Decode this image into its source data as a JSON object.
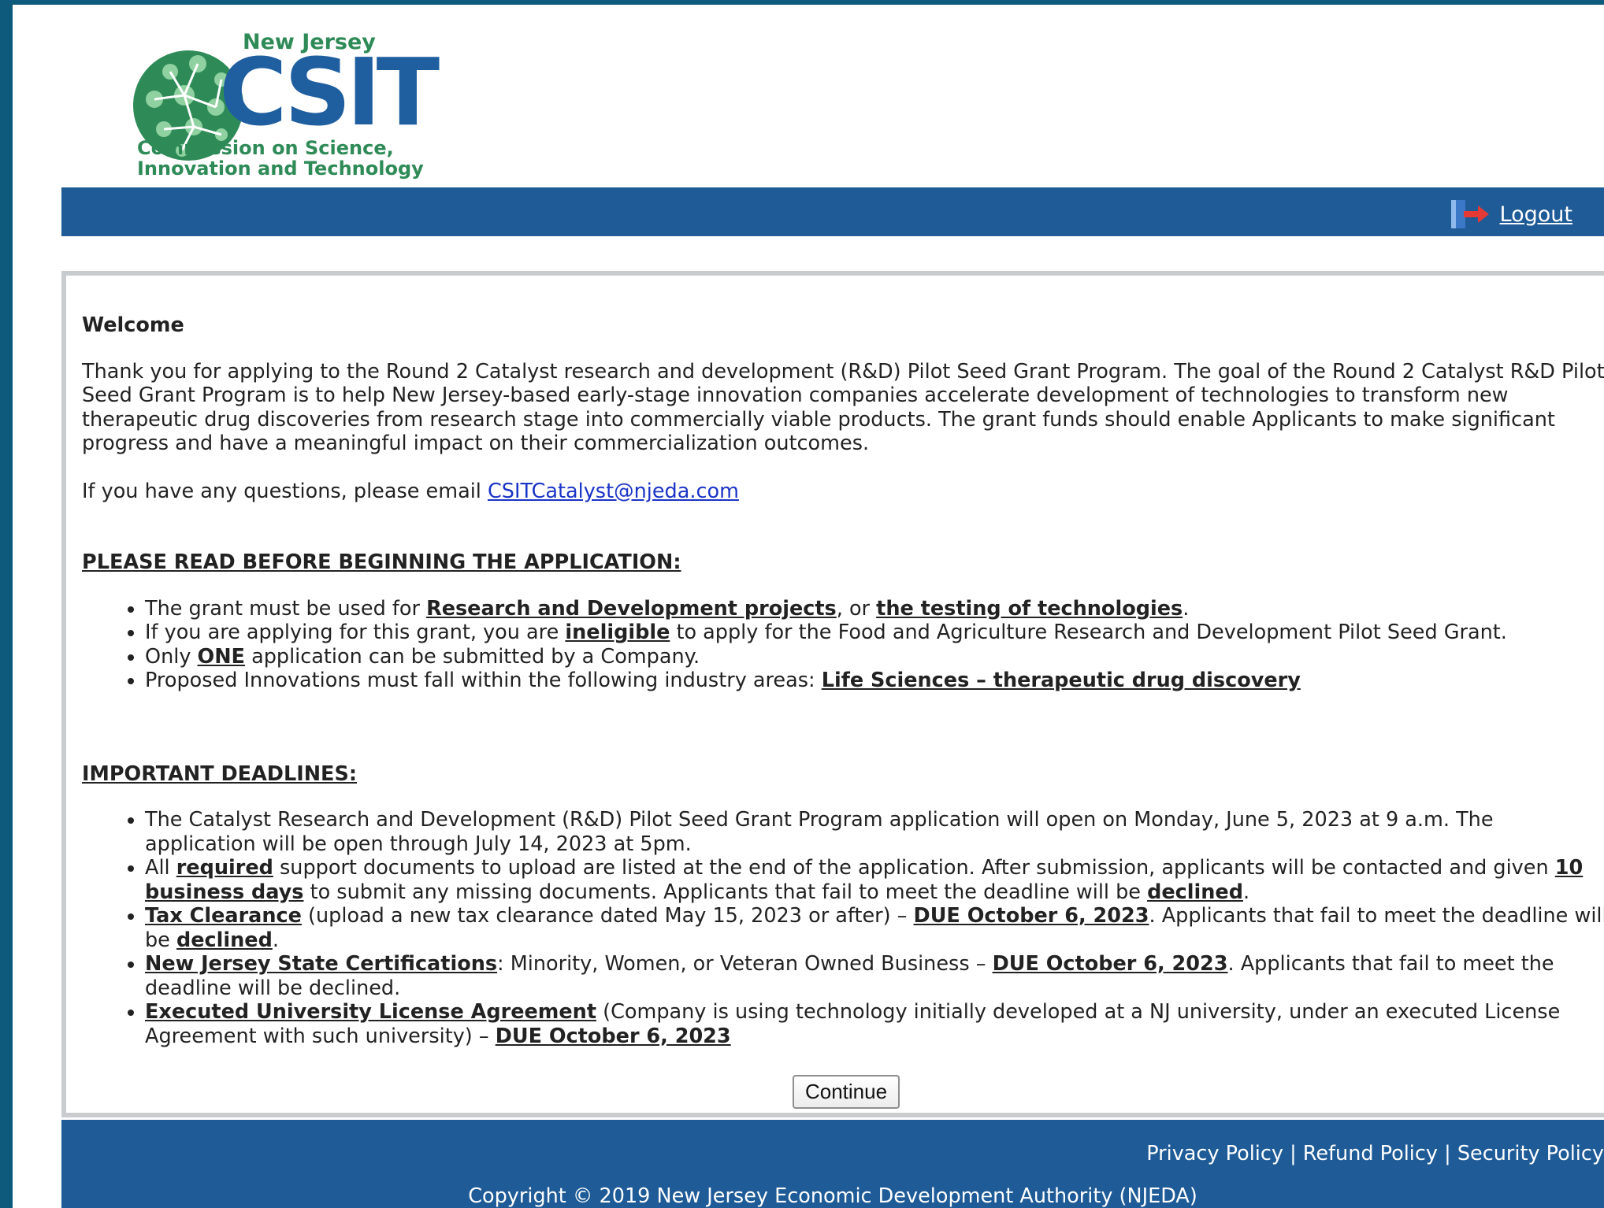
{
  "logo": {
    "line1": "New Jersey",
    "main": "CSIT",
    "line2": "Commission on Science,",
    "line3": "Innovation and Technology"
  },
  "header": {
    "logout_label": "Logout"
  },
  "welcome": {
    "title": "Welcome",
    "intro": "Thank you for applying to the Round 2 Catalyst research and development (R&D) Pilot Seed Grant Program. The goal of the Round 2 Catalyst R&D Pilot Seed Grant Program is to help New Jersey-based early-stage innovation companies accelerate development of technologies to transform new therapeutic drug discoveries from research stage into commercially viable products. The grant funds should enable Applicants to make significant progress and have a meaningful impact on their commercialization outcomes.",
    "questions_prefix": "If you have any questions, please email ",
    "email": "CSITCatalyst@njeda.com"
  },
  "read_before": {
    "heading": "PLEASE READ BEFORE BEGINNING THE APPLICATION:",
    "item1": {
      "a": "The grant must be used for ",
      "b": "Research and Development projects",
      "c": ", or ",
      "d": "the testing of technologies",
      "e": "."
    },
    "item2": {
      "a": "If you are applying for this grant, you are ",
      "b": "ineligible",
      "c": " to apply for the Food and Agriculture Research and Development Pilot Seed Grant."
    },
    "item3": {
      "a": "Only ",
      "b": "ONE",
      "c": " application can be submitted by a Company."
    },
    "item4": {
      "a": "Proposed Innovations must fall within the following industry areas: ",
      "b": "Life Sciences – therapeutic drug discovery"
    }
  },
  "deadlines": {
    "heading": "IMPORTANT DEADLINES:",
    "item1": {
      "a": "The Catalyst Research and Development (R&D) Pilot Seed Grant Program application will open on Monday, June 5, 2023 at 9 a.m. The application will be open through July 14, 2023 at 5pm."
    },
    "item2": {
      "a": "All ",
      "b": "required",
      "c": " support documents to upload are listed at the end of the application. After submission, applicants will be contacted and given ",
      "d": "10 business days",
      "e": " to submit any missing documents. Applicants that fail to meet the deadline will be ",
      "f": "declined",
      "g": "."
    },
    "item3": {
      "a": "Tax Clearance",
      "b": " (upload a new tax clearance dated May 15, 2023 or after) – ",
      "c": "DUE October 6, 2023",
      "d": ". Applicants that fail to meet the deadline will be ",
      "e": "declined",
      "f": "."
    },
    "item4": {
      "a": "New Jersey State Certifications",
      "b": ": Minority, Women, or Veteran Owned Business – ",
      "c": "DUE October 6, 2023",
      "d": ". Applicants that fail to meet the deadline will be declined."
    },
    "item5": {
      "a": "Executed University License Agreement",
      "b": " (Company is using technology initially developed at a NJ university, under an executed License Agreement with such university) – ",
      "c": "DUE October 6, 2023"
    }
  },
  "continue_label": "Continue",
  "footer": {
    "privacy": "Privacy Policy",
    "sep": " | ",
    "refund": "Refund Policy",
    "security": "Security Policy",
    "copyright": "Copyright © 2019 New Jersey Economic Development Authority (NJEDA)"
  },
  "colors": {
    "header_blue": "#1e5b97",
    "outer_teal": "#0d5a7d",
    "logo_green": "#2e8b57",
    "logo_blue": "#1f5fa0"
  }
}
